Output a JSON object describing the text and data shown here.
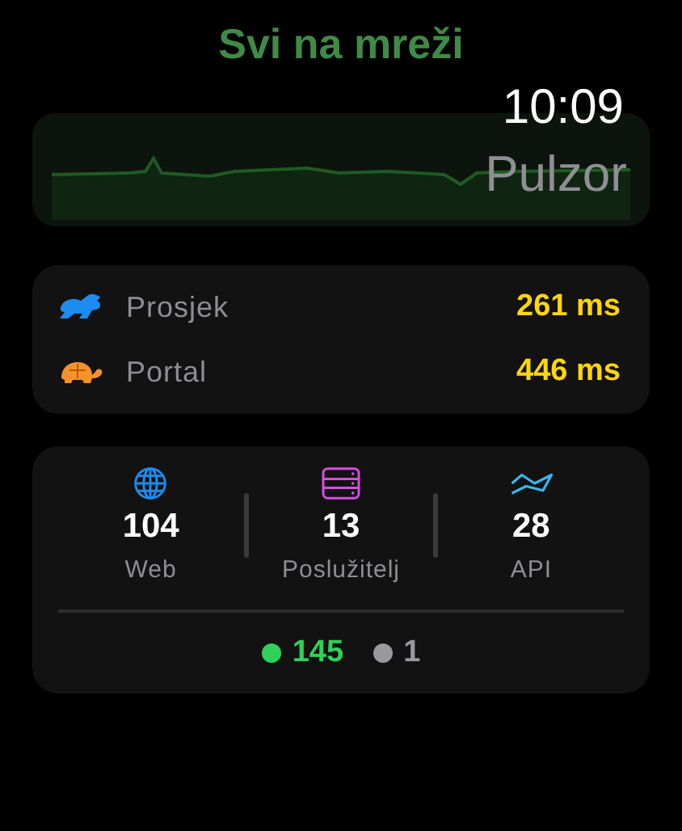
{
  "title": "Svi na mreži",
  "time": "10:09",
  "app_name": "Pulzor",
  "latency": [
    {
      "kind": "rabbit",
      "label": "Prosjek",
      "value": "261 ms"
    },
    {
      "kind": "turtle",
      "label": "Portal",
      "value": "446 ms"
    }
  ],
  "stats": [
    {
      "kind": "web",
      "count": "104",
      "label": "Web"
    },
    {
      "kind": "server",
      "count": "13",
      "label": "Poslužitelj"
    },
    {
      "kind": "api",
      "count": "28",
      "label": "API"
    }
  ],
  "status_counts": [
    {
      "count": "145",
      "color": "#30d158"
    },
    {
      "count": "1",
      "color": "#98989d"
    }
  ]
}
